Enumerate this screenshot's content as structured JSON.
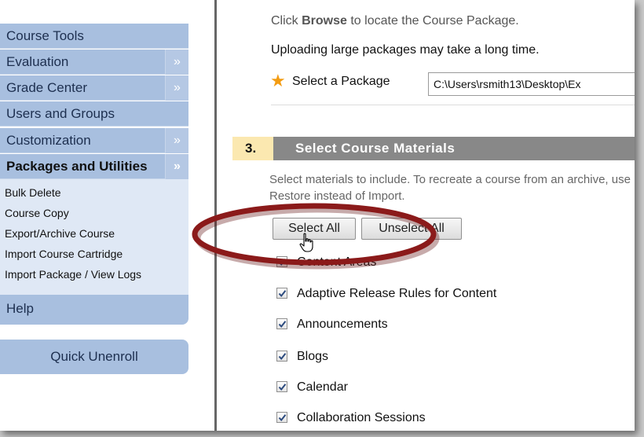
{
  "sidebar": {
    "items": [
      {
        "label": "Course Tools",
        "has_chevron": false
      },
      {
        "label": "Evaluation",
        "has_chevron": true
      },
      {
        "label": "Grade Center",
        "has_chevron": true
      },
      {
        "label": "Users and Groups",
        "has_chevron": false
      },
      {
        "label": "Customization",
        "has_chevron": true
      },
      {
        "label": "Packages and Utilities",
        "has_chevron": true,
        "active": true
      }
    ],
    "chevron_glyph": "»",
    "subitems": [
      "Bulk Delete",
      "Course Copy",
      "Export/Archive Course",
      "Import Course Cartridge",
      "Import Package / View Logs"
    ],
    "help_label": "Help",
    "quick_unenroll_label": "Quick Unenroll"
  },
  "main": {
    "instruction_prefix": "Click ",
    "instruction_bold": "Browse",
    "instruction_suffix": " to locate the Course Package.",
    "upload_note": "Uploading large packages may take a long time.",
    "required_icon": "asterisk-icon",
    "package_label": "Select a Package",
    "package_value": "C:\\Users\\rsmith13\\Desktop\\Ex",
    "step_number": "3.",
    "step_title": "Select Course Materials",
    "select_help": "Select materials to include. To recreate a course from an archive, use Restore instead of Import.",
    "select_all_label": "Select All",
    "unselect_all_label": "Unselect All",
    "materials": [
      {
        "label": "Content Areas",
        "checked": true
      },
      {
        "label": "Adaptive Release Rules for Content",
        "checked": true
      },
      {
        "label": "Announcements",
        "checked": true
      },
      {
        "label": "Blogs",
        "checked": true
      },
      {
        "label": "Calendar",
        "checked": true
      },
      {
        "label": "Collaboration Sessions",
        "checked": true
      }
    ]
  },
  "colors": {
    "sidebar_bg": "#a8bfdf",
    "submenu_bg": "#dfe8f5",
    "step_bar_bg": "#888888",
    "step_num_bg": "#fbe8b0",
    "highlight_ellipse": "#8b1a1a",
    "required_star": "#f39c12"
  }
}
